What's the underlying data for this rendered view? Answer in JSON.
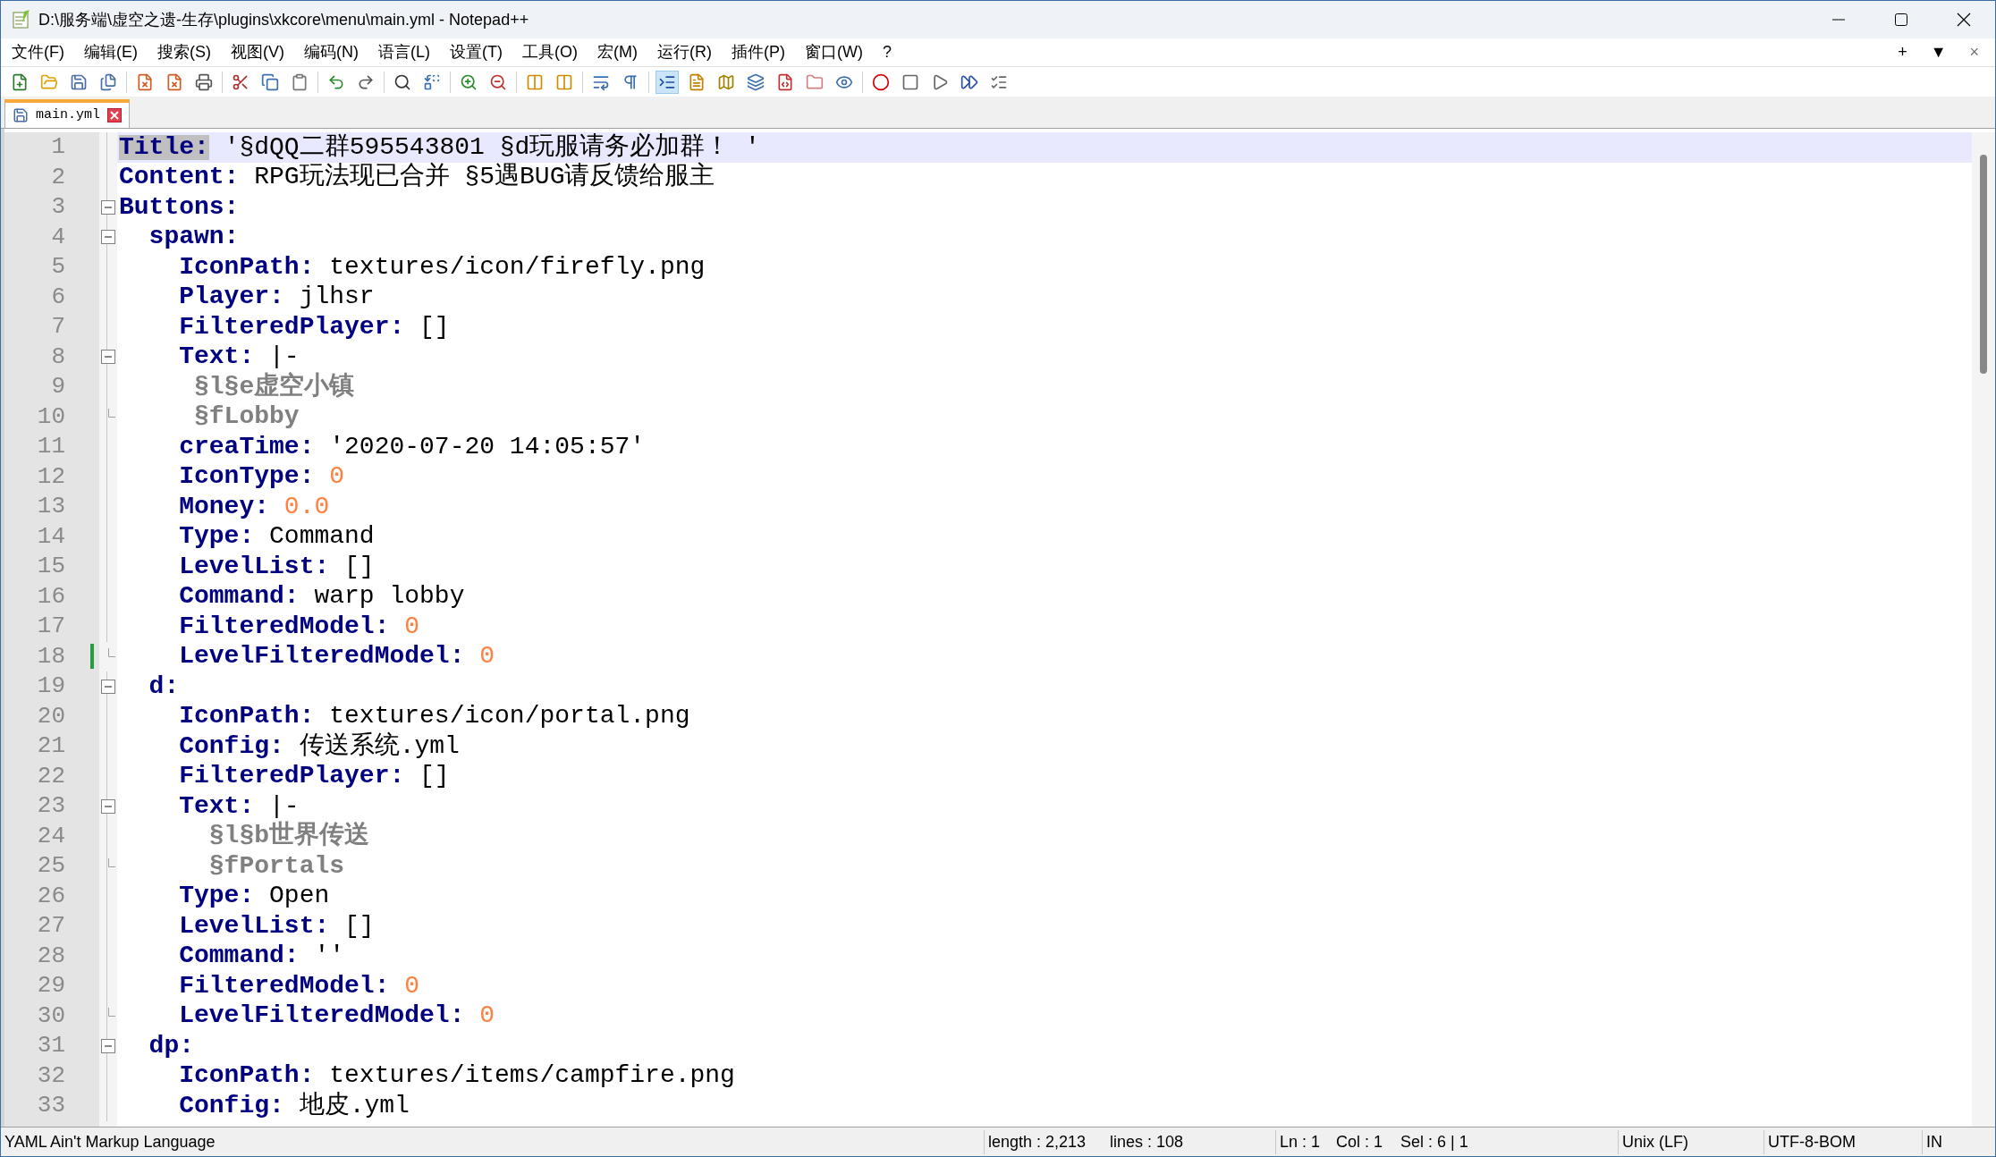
{
  "window": {
    "title": "D:\\服务端\\虚空之遗-生存\\plugins\\xkcore\\menu\\main.yml - Notepad++"
  },
  "menu": [
    "文件(F)",
    "编辑(E)",
    "搜索(S)",
    "视图(V)",
    "编码(N)",
    "语言(L)",
    "设置(T)",
    "工具(O)",
    "宏(M)",
    "运行(R)",
    "插件(P)",
    "窗口(W)",
    "?"
  ],
  "menu_right": [
    "+",
    "▼",
    "×"
  ],
  "tabs": [
    {
      "label": "main.yml",
      "selected": true
    }
  ],
  "lines": [
    {
      "number": "1",
      "foldable": false,
      "fold_end": false,
      "current": true,
      "changed": false,
      "tokens": [
        {
          "kind": "key",
          "text": "Title:"
        },
        {
          "kind": "plain",
          "text": " '§dQQ二群595543801 §d玩服请务必加群！ '"
        }
      ]
    },
    {
      "number": "2",
      "foldable": false,
      "fold_end": false,
      "current": false,
      "changed": false,
      "tokens": [
        {
          "kind": "key",
          "text": "Content:"
        },
        {
          "kind": "plain",
          "text": " RPG玩法现已合并 §5遇BUG请反馈给服主"
        }
      ]
    },
    {
      "number": "3",
      "foldable": true,
      "fold_end": false,
      "current": false,
      "changed": false,
      "tokens": [
        {
          "kind": "key",
          "text": "Buttons:"
        }
      ]
    },
    {
      "number": "4",
      "foldable": true,
      "fold_end": false,
      "current": false,
      "changed": false,
      "tokens": [
        {
          "kind": "key",
          "text": "  spawn:"
        }
      ]
    },
    {
      "number": "5",
      "foldable": false,
      "fold_end": false,
      "current": false,
      "changed": false,
      "tokens": [
        {
          "kind": "key",
          "text": "    IconPath:"
        },
        {
          "kind": "plain",
          "text": " textures/icon/firefly.png"
        }
      ]
    },
    {
      "number": "6",
      "foldable": false,
      "fold_end": false,
      "current": false,
      "changed": false,
      "tokens": [
        {
          "kind": "key",
          "text": "    Player:"
        },
        {
          "kind": "plain",
          "text": " jlhsr"
        }
      ]
    },
    {
      "number": "7",
      "foldable": false,
      "fold_end": false,
      "current": false,
      "changed": false,
      "tokens": [
        {
          "kind": "key",
          "text": "    FilteredPlayer:"
        },
        {
          "kind": "plain",
          "text": " []"
        }
      ]
    },
    {
      "number": "8",
      "foldable": true,
      "fold_end": false,
      "current": false,
      "changed": false,
      "tokens": [
        {
          "kind": "key",
          "text": "    Text:"
        },
        {
          "kind": "plain",
          "text": " |-"
        }
      ]
    },
    {
      "number": "9",
      "foldable": false,
      "fold_end": false,
      "current": false,
      "changed": false,
      "tokens": [
        {
          "kind": "block",
          "text": "     §l§e虚空小镇"
        }
      ]
    },
    {
      "number": "10",
      "foldable": false,
      "fold_end": true,
      "current": false,
      "changed": false,
      "tokens": [
        {
          "kind": "block",
          "text": "     §fLobby"
        }
      ]
    },
    {
      "number": "11",
      "foldable": false,
      "fold_end": false,
      "current": false,
      "changed": false,
      "tokens": [
        {
          "kind": "key",
          "text": "    creaTime:"
        },
        {
          "kind": "plain",
          "text": " '2020-07-20 14:05:57'"
        }
      ]
    },
    {
      "number": "12",
      "foldable": false,
      "fold_end": false,
      "current": false,
      "changed": false,
      "tokens": [
        {
          "kind": "key",
          "text": "    IconType:"
        },
        {
          "kind": "number",
          "text": " 0"
        }
      ]
    },
    {
      "number": "13",
      "foldable": false,
      "fold_end": false,
      "current": false,
      "changed": false,
      "tokens": [
        {
          "kind": "key",
          "text": "    Money:"
        },
        {
          "kind": "number",
          "text": " 0.0"
        }
      ]
    },
    {
      "number": "14",
      "foldable": false,
      "fold_end": false,
      "current": false,
      "changed": false,
      "tokens": [
        {
          "kind": "key",
          "text": "    Type:"
        },
        {
          "kind": "plain",
          "text": " Command"
        }
      ]
    },
    {
      "number": "15",
      "foldable": false,
      "fold_end": false,
      "current": false,
      "changed": false,
      "tokens": [
        {
          "kind": "key",
          "text": "    LevelList:"
        },
        {
          "kind": "plain",
          "text": " []"
        }
      ]
    },
    {
      "number": "16",
      "foldable": false,
      "fold_end": false,
      "current": false,
      "changed": false,
      "tokens": [
        {
          "kind": "key",
          "text": "    Command:"
        },
        {
          "kind": "plain",
          "text": " warp lobby"
        }
      ]
    },
    {
      "number": "17",
      "foldable": false,
      "fold_end": false,
      "current": false,
      "changed": false,
      "tokens": [
        {
          "kind": "key",
          "text": "    FilteredModel:"
        },
        {
          "kind": "number",
          "text": " 0"
        }
      ]
    },
    {
      "number": "18",
      "foldable": false,
      "fold_end": true,
      "current": false,
      "changed": true,
      "tokens": [
        {
          "kind": "key",
          "text": "    LevelFilteredModel:"
        },
        {
          "kind": "number",
          "text": " 0"
        }
      ]
    },
    {
      "number": "19",
      "foldable": true,
      "fold_end": false,
      "current": false,
      "changed": false,
      "tokens": [
        {
          "kind": "key",
          "text": "  d:"
        }
      ]
    },
    {
      "number": "20",
      "foldable": false,
      "fold_end": false,
      "current": false,
      "changed": false,
      "tokens": [
        {
          "kind": "key",
          "text": "    IconPath:"
        },
        {
          "kind": "plain",
          "text": " textures/icon/portal.png"
        }
      ]
    },
    {
      "number": "21",
      "foldable": false,
      "fold_end": false,
      "current": false,
      "changed": false,
      "tokens": [
        {
          "kind": "key",
          "text": "    Config:"
        },
        {
          "kind": "plain",
          "text": " 传送系统.yml"
        }
      ]
    },
    {
      "number": "22",
      "foldable": false,
      "fold_end": false,
      "current": false,
      "changed": false,
      "tokens": [
        {
          "kind": "key",
          "text": "    FilteredPlayer:"
        },
        {
          "kind": "plain",
          "text": " []"
        }
      ]
    },
    {
      "number": "23",
      "foldable": true,
      "fold_end": false,
      "current": false,
      "changed": false,
      "tokens": [
        {
          "kind": "key",
          "text": "    Text:"
        },
        {
          "kind": "plain",
          "text": " |-"
        }
      ]
    },
    {
      "number": "24",
      "foldable": false,
      "fold_end": false,
      "current": false,
      "changed": false,
      "tokens": [
        {
          "kind": "block",
          "text": "      §l§b世界传送"
        }
      ]
    },
    {
      "number": "25",
      "foldable": false,
      "fold_end": true,
      "current": false,
      "changed": false,
      "tokens": [
        {
          "kind": "block",
          "text": "      §fPortals"
        }
      ]
    },
    {
      "number": "26",
      "foldable": false,
      "fold_end": false,
      "current": false,
      "changed": false,
      "tokens": [
        {
          "kind": "key",
          "text": "    Type:"
        },
        {
          "kind": "plain",
          "text": " Open"
        }
      ]
    },
    {
      "number": "27",
      "foldable": false,
      "fold_end": false,
      "current": false,
      "changed": false,
      "tokens": [
        {
          "kind": "key",
          "text": "    LevelList:"
        },
        {
          "kind": "plain",
          "text": " []"
        }
      ]
    },
    {
      "number": "28",
      "foldable": false,
      "fold_end": false,
      "current": false,
      "changed": false,
      "tokens": [
        {
          "kind": "key",
          "text": "    Command:"
        },
        {
          "kind": "plain",
          "text": " ''"
        }
      ]
    },
    {
      "number": "29",
      "foldable": false,
      "fold_end": false,
      "current": false,
      "changed": false,
      "tokens": [
        {
          "kind": "key",
          "text": "    FilteredModel:"
        },
        {
          "kind": "number",
          "text": " 0"
        }
      ]
    },
    {
      "number": "30",
      "foldable": false,
      "fold_end": true,
      "current": false,
      "changed": false,
      "tokens": [
        {
          "kind": "key",
          "text": "    LevelFilteredModel:"
        },
        {
          "kind": "number",
          "text": " 0"
        }
      ]
    },
    {
      "number": "31",
      "foldable": true,
      "fold_end": false,
      "current": false,
      "changed": false,
      "tokens": [
        {
          "kind": "key",
          "text": "  dp:"
        }
      ]
    },
    {
      "number": "32",
      "foldable": false,
      "fold_end": false,
      "current": false,
      "changed": false,
      "tokens": [
        {
          "kind": "key",
          "text": "    IconPath:"
        },
        {
          "kind": "plain",
          "text": " textures/items/campfire.png"
        }
      ]
    },
    {
      "number": "33",
      "foldable": false,
      "fold_end": false,
      "current": false,
      "changed": false,
      "tokens": [
        {
          "kind": "key",
          "text": "    Config:"
        },
        {
          "kind": "plain",
          "text": " 地皮.yml"
        }
      ]
    }
  ],
  "status_bar": {
    "language": "YAML Ain't Markup Language",
    "length": "length : 2,213",
    "lines": "lines : 108",
    "ln": "Ln : 1",
    "col": "Col : 1",
    "sel": "Sel : 6 | 1",
    "eol": "Unix (LF)",
    "encoding": "UTF-8-BOM",
    "mode": "IN"
  }
}
